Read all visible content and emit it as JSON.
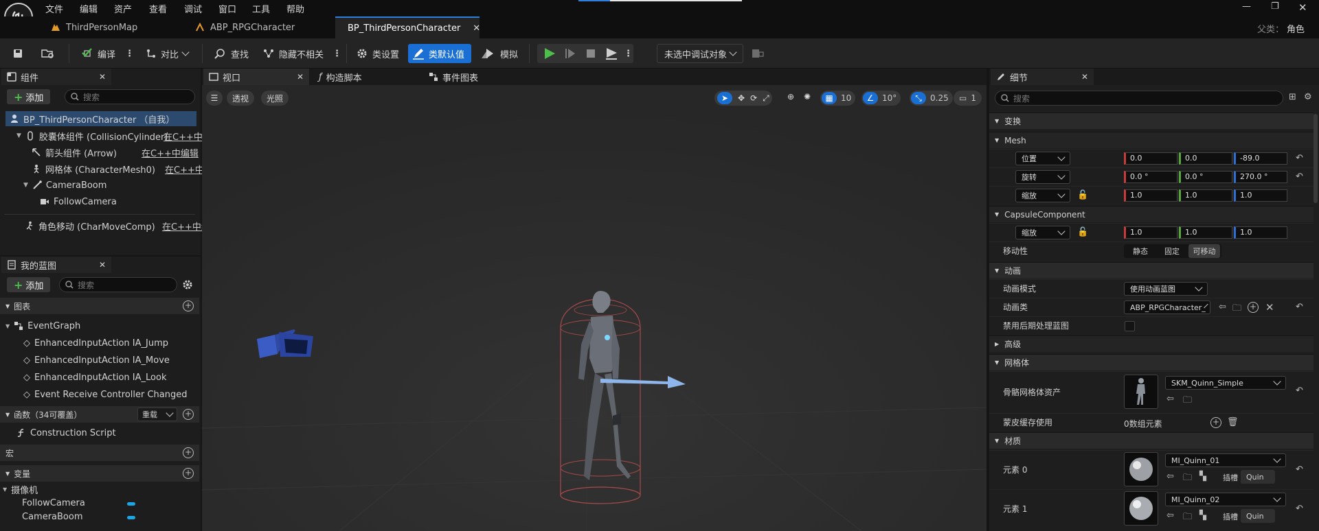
{
  "menu": [
    "文件",
    "编辑",
    "资产",
    "查看",
    "调试",
    "窗口",
    "工具",
    "帮助"
  ],
  "tabs": [
    {
      "label": "ThirdPersonMap"
    },
    {
      "label": "ABP_RPGCharacter"
    },
    {
      "label": "BP_ThirdPersonCharacter"
    }
  ],
  "parent": {
    "label": "父类：",
    "value": "角色"
  },
  "toolbar": {
    "compile": "编译",
    "diff": "对比",
    "find": "查找",
    "hide": "隐藏不相关",
    "class_settings": "类设置",
    "class_defaults": "类默认值",
    "simulate": "模拟",
    "debug_target": "未选中调试对象"
  },
  "components": {
    "tab": "组件",
    "add": "添加",
    "search_placeholder": "搜索",
    "items": [
      {
        "label": "BP_ThirdPersonCharacter （自我）"
      },
      {
        "label": "胶囊体组件 (CollisionCylinder)",
        "edit": "在C++中"
      },
      {
        "label": "箭头组件 (Arrow)",
        "edit": "在C++中编辑"
      },
      {
        "label": "网格体 (CharacterMesh0)",
        "edit": "在C++中编"
      },
      {
        "label": "CameraBoom"
      },
      {
        "label": "FollowCamera"
      },
      {
        "label": "角色移动 (CharMoveComp)",
        "edit": "在C++中编"
      }
    ]
  },
  "my_blueprint": {
    "tab": "我的蓝图",
    "add": "添加",
    "search_placeholder": "搜索",
    "graphs_label": "图表",
    "event_graph": "EventGraph",
    "events": [
      "EnhancedInputAction IA_Jump",
      "EnhancedInputAction IA_Move",
      "EnhancedInputAction IA_Look",
      "Event Receive Controller Changed"
    ],
    "functions_label": "函数（34可覆盖）",
    "override": "重载",
    "construction": "Construction Script",
    "macros_label": "宏",
    "variables_label": "变量",
    "camera_category": "摄像机",
    "variables": [
      "FollowCamera",
      "CameraBoom"
    ]
  },
  "viewport": {
    "tabs": [
      "视口",
      "构造脚本",
      "事件图表"
    ],
    "perspective": "透视",
    "lighting": "光照",
    "grid": "10",
    "angle": "10°",
    "scale": "0.25",
    "cam_speed": "1"
  },
  "details": {
    "tab": "细节",
    "search_placeholder": "搜索",
    "transform": "变换",
    "mesh": "Mesh",
    "location_label": "位置",
    "location": [
      "0.0",
      "0.0",
      "-89.0"
    ],
    "rotation_label": "旋转",
    "rotation": [
      "0.0 °",
      "0.0 °",
      "270.0 °"
    ],
    "scale_label": "缩放",
    "scale": [
      "1.0",
      "1.0",
      "1.0"
    ],
    "capsule": "CapsuleComponent",
    "capsule_scale": [
      "1.0",
      "1.0",
      "1.0"
    ],
    "mobility_label": "移动性",
    "mobility": [
      "静态",
      "固定",
      "可移动"
    ],
    "animation": "动画",
    "anim_mode_label": "动画模式",
    "anim_mode": "使用动画蓝图",
    "anim_class_label": "动画类",
    "anim_class": "ABP_RPGCharacter_",
    "disable_post": "禁用后期处理蓝图",
    "advanced": "高级",
    "mesh_cat": "网格体",
    "skeletal_mesh_label": "骨骼网格体资产",
    "skeletal_mesh": "SKM_Quinn_Simple",
    "skin_cache_label": "蒙皮缓存使用",
    "skin_cache": "0数组元素",
    "materials": "材质",
    "element0_label": "元素 0",
    "element0": "MI_Quinn_01",
    "element1_label": "元素 1",
    "element1": "MI_Quinn_02",
    "slot_label": "插槽",
    "slot_value": "Quin"
  },
  "colors": {
    "accent": "#1a6fd4",
    "x": "#c73b3b",
    "y": "#57a73b",
    "z": "#2f6fd4",
    "variable": "#1ba7e6"
  }
}
